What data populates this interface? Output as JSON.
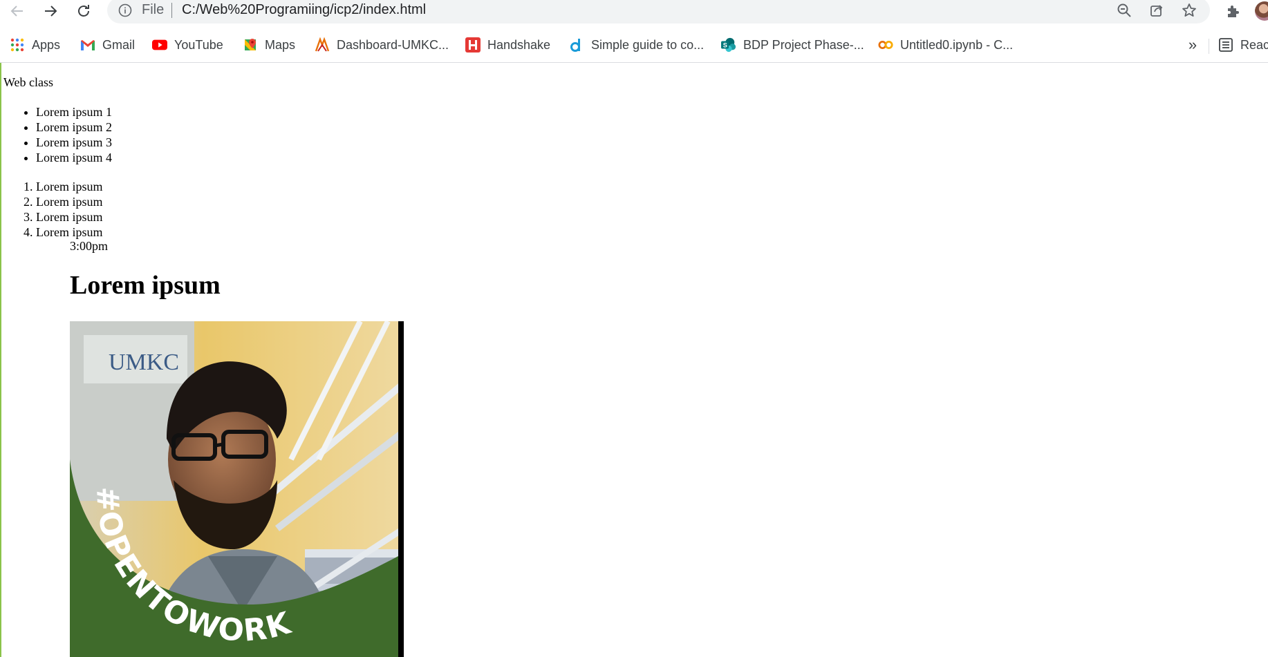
{
  "browser": {
    "url_scheme_label": "File",
    "url": "C:/Web%20Programiing/icp2/index.html",
    "bookmarks": [
      {
        "label": "Apps",
        "icon": "apps-grid-icon"
      },
      {
        "label": "Gmail",
        "icon": "gmail-icon"
      },
      {
        "label": "YouTube",
        "icon": "youtube-icon"
      },
      {
        "label": "Maps",
        "icon": "maps-icon"
      },
      {
        "label": "Dashboard-UMKC...",
        "icon": "umkc-dashboard-icon"
      },
      {
        "label": "Handshake",
        "icon": "handshake-icon"
      },
      {
        "label": "Simple guide to co...",
        "icon": "docs-d-icon"
      },
      {
        "label": "BDP Project Phase-...",
        "icon": "sharepoint-icon"
      },
      {
        "label": "Untitled0.ipynb - C...",
        "icon": "colab-icon"
      }
    ],
    "overflow_label": "»",
    "reading_list_label": "Reac",
    "colors": {
      "omnibox_bg": "#f1f3f4",
      "bookmark_text": "#3c4043",
      "youtube_red": "#ff0000",
      "handshake_red": "#e53935",
      "colab_orange": "#f9ab00",
      "photo_frame_green": "#3f6b2b"
    }
  },
  "page": {
    "heading_text": "Web class",
    "bullet_items": [
      "Lorem ipsum 1",
      "Lorem ipsum 2",
      "Lorem ipsum 3",
      "Lorem ipsum 4"
    ],
    "numbered_items": [
      "Lorem ipsum",
      "Lorem ipsum",
      "Lorem ipsum",
      "Lorem ipsum"
    ],
    "time": "3:00pm",
    "h1": "Lorem ipsum",
    "photo": {
      "badge_text": "#OPENTOWORK",
      "sign_text": "UMKC"
    }
  }
}
